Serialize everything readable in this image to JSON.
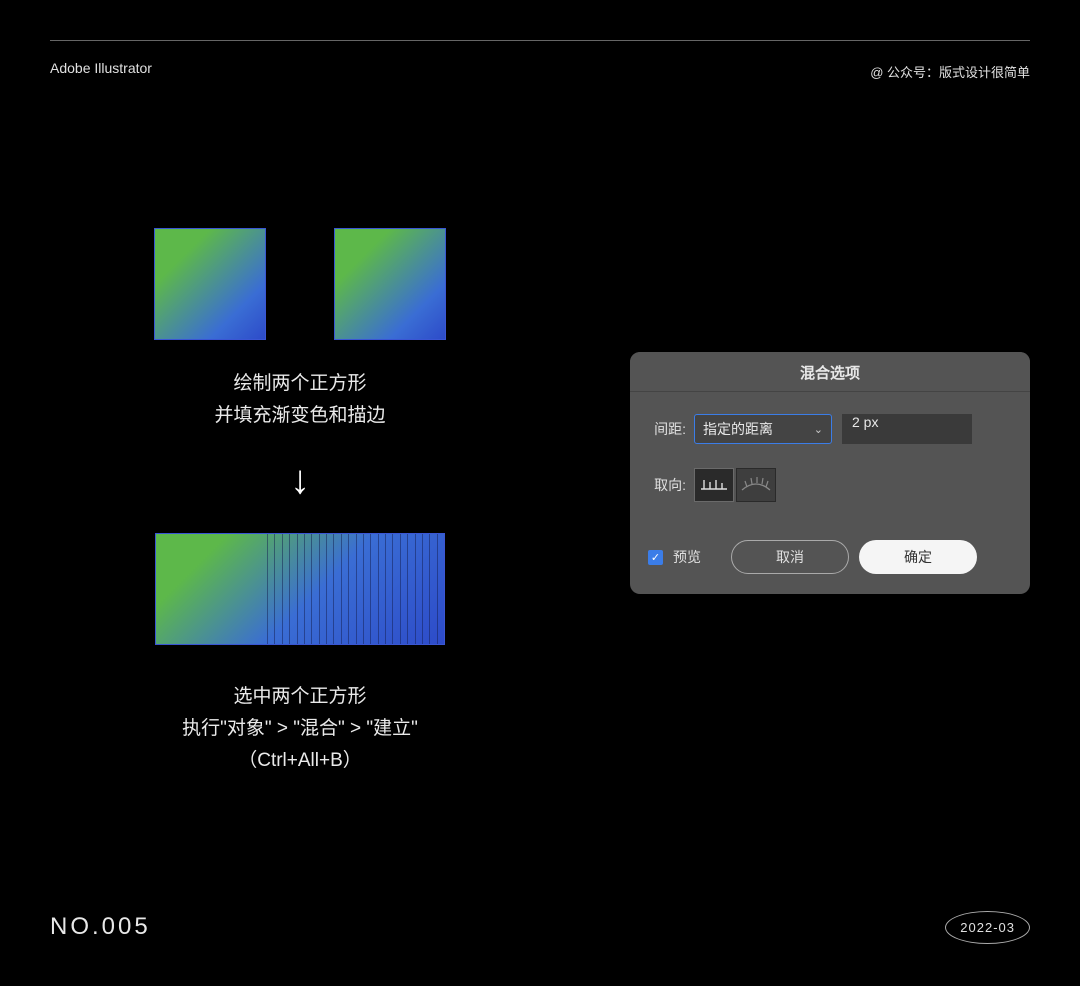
{
  "header": {
    "left": "Adobe Illustrator",
    "right": "@ 公众号：版式设计很简单"
  },
  "step1": {
    "line1": "绘制两个正方形",
    "line2": "并填充渐变色和描边"
  },
  "arrow": "↓",
  "step2": {
    "line1": "选中两个正方形",
    "line2": "执行\"对象\" > \"混合\" > \"建立\"",
    "line3": "（Ctrl+All+B）"
  },
  "dialog": {
    "title": "混合选项",
    "spacing_label": "间距:",
    "spacing_mode": "指定的距离",
    "spacing_value": "2 px",
    "orient_label": "取向:",
    "preview_label": "预览",
    "cancel": "取消",
    "ok": "确定"
  },
  "footer": {
    "left": "NO.005",
    "right": "2022-03"
  },
  "colors": {
    "gradient_start": "#5db84a",
    "gradient_end": "#2d4bc9",
    "accent": "#3b7de8"
  }
}
